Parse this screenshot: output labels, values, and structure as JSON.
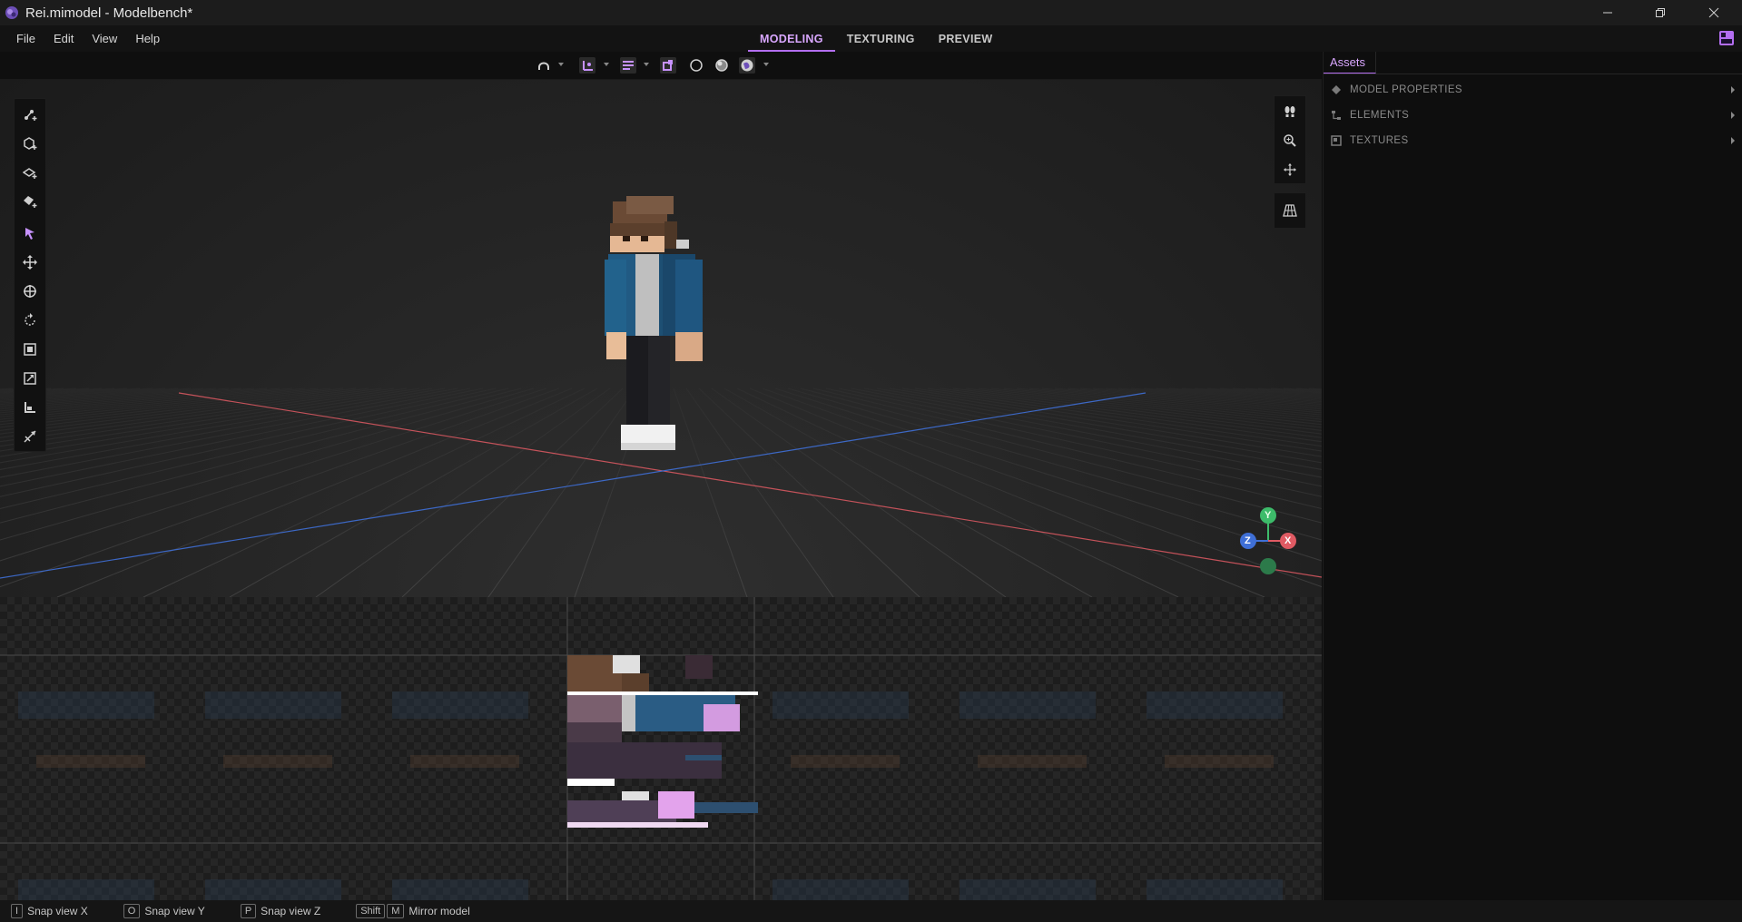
{
  "window": {
    "title": "Rei.mimodel - Modelbench*",
    "controls": [
      "minimize",
      "restore",
      "close"
    ]
  },
  "menu": {
    "items": [
      {
        "label": "File"
      },
      {
        "label": "Edit"
      },
      {
        "label": "View"
      },
      {
        "label": "Help"
      }
    ]
  },
  "modes": {
    "tabs": [
      {
        "label": "MODELING",
        "active": true
      },
      {
        "label": "TEXTURING",
        "active": false
      },
      {
        "label": "PREVIEW",
        "active": false
      }
    ]
  },
  "toolbar": {
    "items": [
      "snap-magnet-icon",
      "transform-space-icon",
      "pivot-mode-icon",
      "paint-bucket-icon",
      "wireframe-shading-icon",
      "solid-shading-icon",
      "textured-shading-icon"
    ]
  },
  "viewport": {
    "left_tools": [
      "create-bone-icon",
      "create-cube-icon",
      "create-plane-icon",
      "create-mesh-icon",
      "select-icon",
      "move-icon",
      "pivot-icon",
      "rotate-icon",
      "scale-icon",
      "resize-icon",
      "bend-icon",
      "shear-icon"
    ],
    "right_tools": [
      "walk-icon",
      "zoom-icon",
      "pan-icon",
      "grid-toggle-icon"
    ],
    "gizmo": {
      "x": "X",
      "y": "Y",
      "z": "Z"
    },
    "colors": {
      "x_axis": "#e05a63",
      "y_axis": "#3dbb6a",
      "z_axis": "#3f6fd6"
    }
  },
  "assets": {
    "tab": "Assets",
    "sections": [
      {
        "label": "MODEL PROPERTIES",
        "icon": "model-properties-icon"
      },
      {
        "label": "ELEMENTS",
        "icon": "elements-icon"
      },
      {
        "label": "TEXTURES",
        "icon": "textures-icon"
      }
    ]
  },
  "status": {
    "hints": [
      {
        "keys": [
          "I"
        ],
        "label": "Snap view X"
      },
      {
        "keys": [
          "O"
        ],
        "label": "Snap view Y"
      },
      {
        "keys": [
          "P"
        ],
        "label": "Snap view Z"
      },
      {
        "keys": [
          "Shift",
          "M"
        ],
        "label": "Mirror model"
      }
    ]
  },
  "theme": {
    "accent": "#b36ef0",
    "accent_text": "#d9a7ff"
  }
}
